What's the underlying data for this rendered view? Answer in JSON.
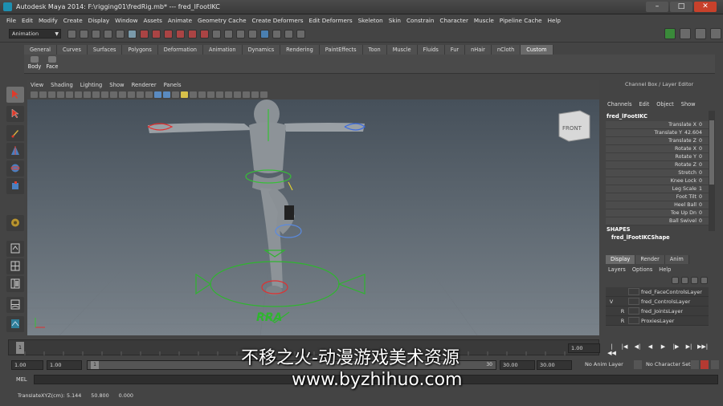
{
  "window": {
    "title": "Autodesk Maya 2014: F:\\rigging01\\fredRig.mb*   ---   fred_lFootIKC",
    "minimize": "–",
    "maximize": "□",
    "close": "✕"
  },
  "menubar": [
    "File",
    "Edit",
    "Modify",
    "Create",
    "Display",
    "Window",
    "Assets",
    "Animate",
    "Geometry Cache",
    "Create Deformers",
    "Edit Deformers",
    "Skeleton",
    "Skin",
    "Constrain",
    "Character",
    "Muscle",
    "Pipeline Cache",
    "Help"
  ],
  "statusline": {
    "mode": "Animation"
  },
  "shelf": {
    "tabs": [
      "General",
      "Curves",
      "Surfaces",
      "Polygons",
      "Deformation",
      "Animation",
      "Dynamics",
      "Rendering",
      "PaintEffects",
      "Toon",
      "Muscle",
      "Fluids",
      "Fur",
      "nHair",
      "nCloth",
      "Custom"
    ],
    "active_tab": "Custom",
    "buttons": [
      "Body",
      "Face"
    ]
  },
  "panel": {
    "menus": [
      "View",
      "Shading",
      "Lighting",
      "Show",
      "Renderer",
      "Panels"
    ],
    "viewcube": "FRONT",
    "rig_label": "RRA"
  },
  "channel_box": {
    "title": "Channel Box / Layer Editor",
    "menus": [
      "Channels",
      "Edit",
      "Object",
      "Show"
    ],
    "node": "fred_lFootIKC",
    "attributes": [
      {
        "label": "Translate X",
        "value": "0"
      },
      {
        "label": "Translate Y",
        "value": "42.604"
      },
      {
        "label": "Translate Z",
        "value": "0"
      },
      {
        "label": "Rotate X",
        "value": "0"
      },
      {
        "label": "Rotate Y",
        "value": "0"
      },
      {
        "label": "Rotate Z",
        "value": "0"
      },
      {
        "label": "Stretch",
        "value": "0"
      },
      {
        "label": "Knee Lock",
        "value": "0"
      },
      {
        "label": "Leg Scale",
        "value": "1"
      },
      {
        "label": "Foot Tilt",
        "value": "0"
      },
      {
        "label": "Heel Ball",
        "value": "0"
      },
      {
        "label": "Toe Up Dn",
        "value": "0"
      },
      {
        "label": "Ball Swivel",
        "value": "0"
      }
    ],
    "shapes_header": "SHAPES",
    "shape": "fred_lFootIKCShape"
  },
  "layer_editor": {
    "tabs": [
      "Display",
      "Render",
      "Anim"
    ],
    "active_tab": "Display",
    "menus": [
      "Layers",
      "Options",
      "Help"
    ],
    "layers": [
      {
        "v": "",
        "r": "",
        "name": "fred_FaceControlsLayer"
      },
      {
        "v": "V",
        "r": "",
        "name": "fred_ControlsLayer"
      },
      {
        "v": "",
        "r": "R",
        "name": "fred_JointsLayer"
      },
      {
        "v": "",
        "r": "R",
        "name": "ProxiesLayer"
      }
    ]
  },
  "time": {
    "current_marker": "1",
    "current_frame": "1.00",
    "playback": [
      "|◀◀",
      "|◀",
      "◀|",
      "◀",
      "▶",
      "|▶",
      "▶|",
      "▶▶|"
    ]
  },
  "range": {
    "start": "1.00",
    "inner_start": "1.00",
    "handle": "1",
    "handle_end": "30",
    "inner_end": "30.00",
    "end": "30.00",
    "anim_layer": "No Anim Layer",
    "character_set": "No Character Set"
  },
  "command": {
    "label": "MEL"
  },
  "help": {
    "text": "TranslateXYZ(cm):",
    "values": [
      "5.144",
      "50.800",
      "0.000"
    ]
  },
  "watermark": {
    "cn": "不移之火-动漫游戏美术资源",
    "url": "www.byzhihuo.com"
  }
}
